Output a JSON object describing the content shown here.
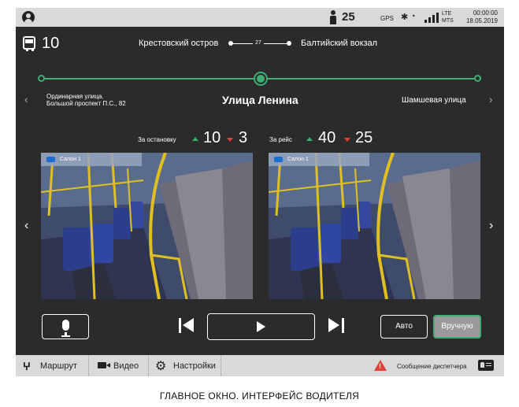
{
  "status_bar": {
    "passenger_count": "25",
    "gps": "GPS",
    "network_lte": "LTE",
    "operator": "MTS",
    "time": "00:00:00",
    "date": "18.05.2019",
    "icons": [
      "user-avatar-icon",
      "person-icon",
      "bluetooth-icon",
      "wifi-icon",
      "signal-icon"
    ]
  },
  "route": {
    "number": "10",
    "from": "Крестовский остров",
    "stops_count": "27",
    "to": "Балтийский вокзал"
  },
  "stops": {
    "previous": "Ординарная улица.",
    "previous_line2": "Большой проспект П.С., 82",
    "current": "Улица Ленина",
    "next": "Шамшевая улица",
    "progress_percent": 50
  },
  "counters": {
    "per_stop_label": "За остановку",
    "per_stop_in": "10",
    "per_stop_out": "3",
    "per_trip_label": "За рейс",
    "per_trip_in": "40",
    "per_trip_out": "25"
  },
  "cameras": [
    {
      "label": "Салон 1"
    },
    {
      "label": "Салон 1"
    }
  ],
  "controls": {
    "auto": "Авто",
    "manual": "Вручную",
    "active_mode": "manual"
  },
  "bottom_bar": {
    "route_tab": "Маршрут",
    "video_tab": "Видео",
    "settings_tab": "Настройки",
    "dispatcher_message": "Сообщение диспетчера"
  },
  "colors": {
    "accent_green": "#3fae73",
    "alert_red": "#e2413b",
    "background": "#2b2b2b",
    "bars": "#d9d9d9"
  },
  "caption": "ГЛАВНОЕ ОКНО. ИНТЕРФЕЙС ВОДИТЕЛЯ"
}
